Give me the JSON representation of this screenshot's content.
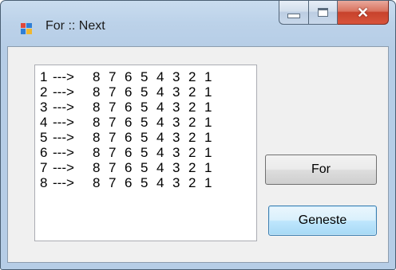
{
  "window": {
    "title": "For :: Next",
    "minimize_label": "minimize",
    "maximize_label": "maximize",
    "close_label": "close"
  },
  "listbox": {
    "rows": [
      {
        "index": "1",
        "arrow": "--->",
        "values": [
          "8",
          "7",
          "6",
          "5",
          "4",
          "3",
          "2",
          "1"
        ]
      },
      {
        "index": "2",
        "arrow": "--->",
        "values": [
          "8",
          "7",
          "6",
          "5",
          "4",
          "3",
          "2",
          "1"
        ]
      },
      {
        "index": "3",
        "arrow": "--->",
        "values": [
          "8",
          "7",
          "6",
          "5",
          "4",
          "3",
          "2",
          "1"
        ]
      },
      {
        "index": "4",
        "arrow": "--->",
        "values": [
          "8",
          "7",
          "6",
          "5",
          "4",
          "3",
          "2",
          "1"
        ]
      },
      {
        "index": "5",
        "arrow": "--->",
        "values": [
          "8",
          "7",
          "6",
          "5",
          "4",
          "3",
          "2",
          "1"
        ]
      },
      {
        "index": "6",
        "arrow": "--->",
        "values": [
          "8",
          "7",
          "6",
          "5",
          "4",
          "3",
          "2",
          "1"
        ]
      },
      {
        "index": "7",
        "arrow": "--->",
        "values": [
          "8",
          "7",
          "6",
          "5",
          "4",
          "3",
          "2",
          "1"
        ]
      },
      {
        "index": "8",
        "arrow": "--->",
        "values": [
          "8",
          "7",
          "6",
          "5",
          "4",
          "3",
          "2",
          "1"
        ]
      }
    ]
  },
  "buttons": {
    "for_label": "For",
    "geneste_label": "Geneste"
  },
  "icons": {
    "app": "windows-form-icon",
    "minimize": "minimize-icon",
    "maximize": "maximize-icon",
    "close": "close-icon"
  },
  "colors": {
    "title_bar": "#bcd2e9",
    "close_button": "#c7422c",
    "form_background": "#f0f0f0",
    "default_button_border": "#3c7fb1"
  }
}
